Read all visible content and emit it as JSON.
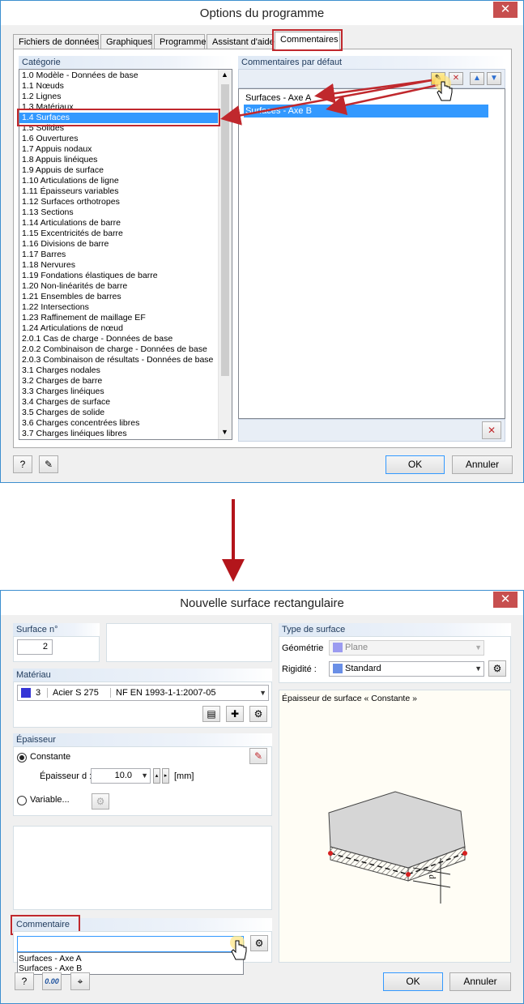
{
  "dialog1": {
    "title": "Options du programme",
    "close": "✕",
    "tabs": [
      "Fichiers de données",
      "Graphiques",
      "Programme",
      "Assistant d'aide",
      "Commentaires"
    ],
    "category_header": "Catégorie",
    "categories": [
      "1.0 Modèle - Données de base",
      "1.1 Nœuds",
      "1.2 Lignes",
      "1.3 Matériaux",
      "1.4 Surfaces",
      "1.5 Solides",
      "1.6 Ouvertures",
      "1.7 Appuis nodaux",
      "1.8 Appuis linéiques",
      "1.9 Appuis de surface",
      "1.10 Articulations de ligne",
      "1.11 Épaisseurs variables",
      "1.12 Surfaces orthotropes",
      "1.13 Sections",
      "1.14 Articulations de barre",
      "1.15 Excentricités de barre",
      "1.16 Divisions de barre",
      "1.17 Barres",
      "1.18 Nervures",
      "1.19 Fondations élastiques de barre",
      "1.20 Non-linéarités de barre",
      "1.21 Ensembles de barres",
      "1.22 Intersections",
      "1.23 Raffinement de maillage EF",
      "1.24 Articulations de nœud",
      "2.0.1 Cas de charge - Données de base",
      "2.0.2 Combinaison de charge - Données de base",
      "2.0.3 Combinaison de résultats - Données de base",
      "3.1 Charges nodales",
      "3.2 Charges de barre",
      "3.3 Charges linéiques",
      "3.4 Charges de surface",
      "3.5 Charges de solide",
      "3.6 Charges concentrées libres",
      "3.7 Charges linéiques libres"
    ],
    "selected_category": "1.4 Surfaces",
    "comments_header": "Commentaires par défaut",
    "comments": [
      "Surfaces - Axe A",
      "Surfaces - Axe B"
    ],
    "ok": "OK",
    "cancel": "Annuler"
  },
  "dialog2": {
    "title": "Nouvelle surface rectangulaire",
    "close": "✕",
    "surface_no_label": "Surface n°",
    "surface_no_value": "2",
    "surface_type_header": "Type de surface",
    "geometry_label": "Géométrie",
    "geometry_value": "Plane",
    "geometry_color": "#9b9bf0",
    "rigidity_label": "Rigidité :",
    "rigidity_value": "Standard",
    "rigidity_color": "#6a8fe6",
    "material_header": "Matériau",
    "material_no": "3",
    "material_name": "Acier S 275",
    "material_norm": "NF EN 1993-1-1:2007-05",
    "material_color": "#3535d6",
    "thickness_header": "Épaisseur",
    "constant_label": "Constante",
    "thickness_d_label": "Épaisseur d :",
    "thickness_value": "10.0",
    "unit": "[mm]",
    "variable_label": "Variable...",
    "preview_title": "Épaisseur de surface « Constante »",
    "preview_d": "d",
    "comment_header": "Commentaire",
    "comment_options": [
      "Surfaces - Axe A",
      "Surfaces - Axe B"
    ],
    "status_value": "0.00",
    "ok": "OK",
    "cancel": "Annuler"
  },
  "colors": {
    "selection": "#3399ff",
    "highlight_frame": "#c0282d",
    "arrow": "#c0282d"
  }
}
